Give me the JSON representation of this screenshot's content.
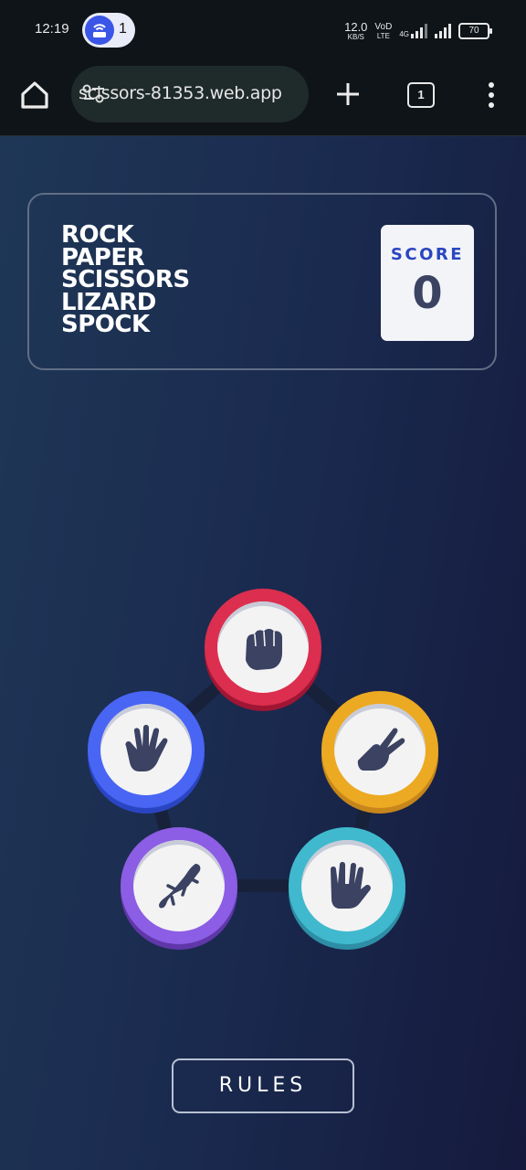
{
  "status_bar": {
    "time": "12:19",
    "notification_count": "1",
    "speed_value": "12.0",
    "speed_unit": "KB/S",
    "network_label_1": "VoD",
    "network_label_2": "LTE",
    "network_type": "4G",
    "battery": "70"
  },
  "browser": {
    "url": "scissors-81353.web.app",
    "tab_count": "1"
  },
  "game": {
    "title_lines": [
      "ROCK",
      "PAPER",
      "SCISSORS",
      "LIZARD",
      "SPOCK"
    ],
    "score_label": "SCORE",
    "score_value": "0",
    "rules_label": "RULES",
    "tokens": {
      "rock": {
        "icon": "rock-fist-icon",
        "color": "#dc2e4e"
      },
      "scissors": {
        "icon": "scissors-hand-icon",
        "color": "#eca922"
      },
      "spock": {
        "icon": "spock-hand-icon",
        "color": "#40b9ce"
      },
      "lizard": {
        "icon": "lizard-icon",
        "color": "#8c5de5"
      },
      "paper": {
        "icon": "paper-hand-icon",
        "color": "#4865f4"
      }
    }
  }
}
